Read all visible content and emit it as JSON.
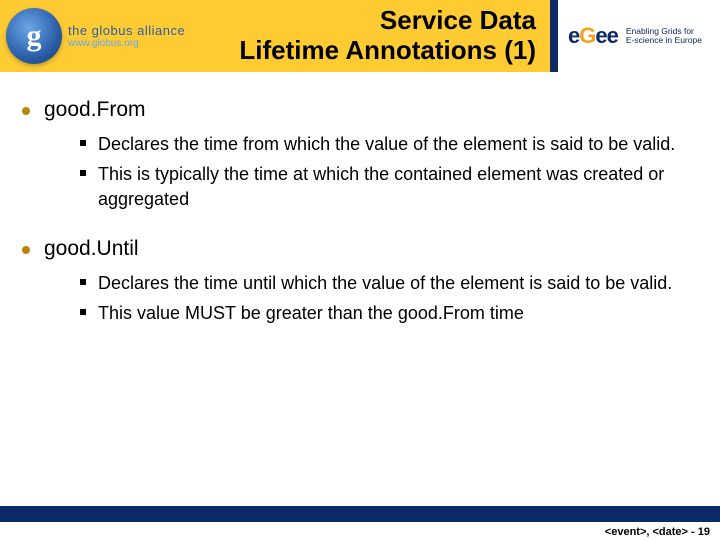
{
  "header": {
    "globus": {
      "letter": "g",
      "line1": "the globus alliance",
      "line2": "www.globus.org"
    },
    "title_line1": "Service Data",
    "title_line2": "Lifetime Annotations (1)",
    "egee": {
      "mark1": "e",
      "mark2": "G",
      "mark3": "ee",
      "tag1": "Enabling Grids for",
      "tag2": "E-science in Europe"
    }
  },
  "body": {
    "items": [
      {
        "label": "good.From",
        "subs": [
          "Declares the time from which the value of the element is said to be valid.",
          "This is typically the time at which the contained element was created or aggregated"
        ]
      },
      {
        "label": "good.Until",
        "subs": [
          "Declares the time until which the value of the element is said to be valid.",
          "This value MUST be greater than the good.From time"
        ]
      }
    ]
  },
  "footer": {
    "meta": "<event>, <date>",
    "sep": "  -  ",
    "page": "19"
  }
}
